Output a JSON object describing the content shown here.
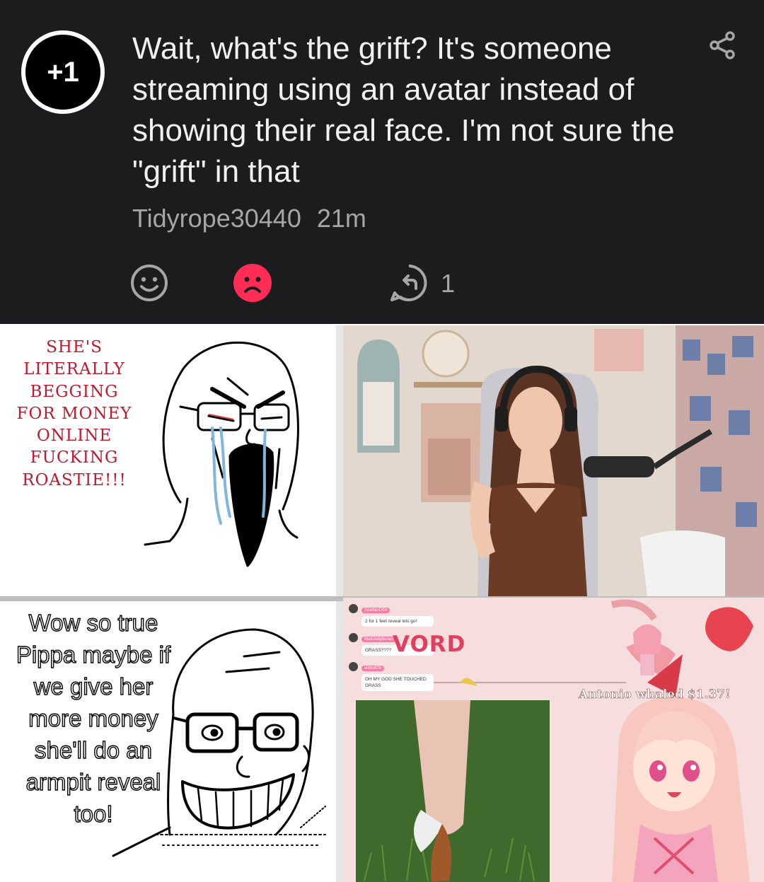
{
  "comment": {
    "badge": "+1",
    "text": "Wait, what's the grift? It's someone streaming using an avatar instead of showing their real face. I'm not sure the \"grift\" in that",
    "username": "Tidyrope30440",
    "time": "21m",
    "reply_count": "1",
    "icons": [
      "share-icon",
      "smile-icon",
      "frown-icon",
      "reply-icon"
    ],
    "colors": {
      "background": "#1c1c1e",
      "downvote_active": "#ff2d55",
      "muted_text": "#a6a6a6"
    }
  },
  "meme": {
    "rage_caption": "SHE'S LITERALLY BEGGING FOR MONEY ONLINE FUCKING ROASTIE!!!",
    "happy_caption": "Wow so true Pippa maybe if we give her more money she'll do an armpit reveal too!",
    "vtuber_stream": {
      "chat": [
        {
          "user": "SpartanD63",
          "message": "2 for 1 feet reveal lets go!"
        },
        {
          "user": "MultiJellybones",
          "message": "GRASS????"
        },
        {
          "user": "vizbo826",
          "message": "OH MY GOD SHE TOUCHED GRASS"
        }
      ],
      "word_banner": "VORD",
      "donation": "Antonio whaled $1.37!"
    },
    "colors": {
      "caption_red": "#c0182d",
      "stream_pink": "#f7dede"
    }
  }
}
